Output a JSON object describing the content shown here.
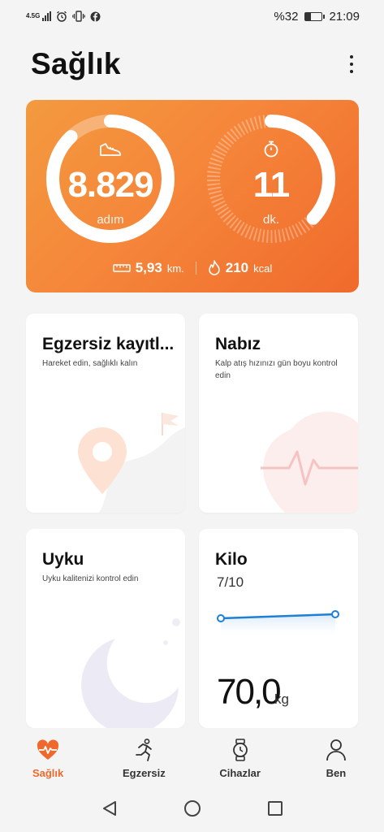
{
  "status_bar": {
    "network": "4.5G",
    "battery": "%32",
    "time": "21:09",
    "battery_level": 0.32
  },
  "header": {
    "title": "Sağlık"
  },
  "activity": {
    "steps_value": "8.829",
    "steps_unit": "adım",
    "steps_progress": 0.88,
    "minutes_value": "11",
    "minutes_unit": "dk.",
    "minutes_progress": 0.37,
    "distance_value": "5,93",
    "distance_unit": "km.",
    "calories_value": "210",
    "calories_unit": "kcal",
    "colors": {
      "card": "#f5863a",
      "ring": "#ffffff"
    }
  },
  "cards": {
    "exercise": {
      "title": "Egzersiz kayıtl...",
      "subtitle": "Hareket edin, sağlıklı kalın"
    },
    "heart": {
      "title": "Nabız",
      "subtitle": "Kalp atış hızınızı gün boyu kontrol edin"
    },
    "sleep": {
      "title": "Uyku",
      "subtitle": "Uyku kalitenizi kontrol edin"
    },
    "weight": {
      "title": "Kilo",
      "date": "7/10",
      "value": "70,0",
      "unit": "kg",
      "line_color": "#1e7fd6"
    }
  },
  "bottom_nav": {
    "items": [
      {
        "label": "Sağlık",
        "icon": "heart-pulse-icon",
        "active": true
      },
      {
        "label": "Egzersiz",
        "icon": "running-icon",
        "active": false
      },
      {
        "label": "Cihazlar",
        "icon": "watch-icon",
        "active": false
      },
      {
        "label": "Ben",
        "icon": "person-icon",
        "active": false
      }
    ],
    "accent": "#f0692c"
  },
  "system_nav": {
    "buttons": [
      "back-icon",
      "home-icon",
      "recents-icon"
    ]
  }
}
